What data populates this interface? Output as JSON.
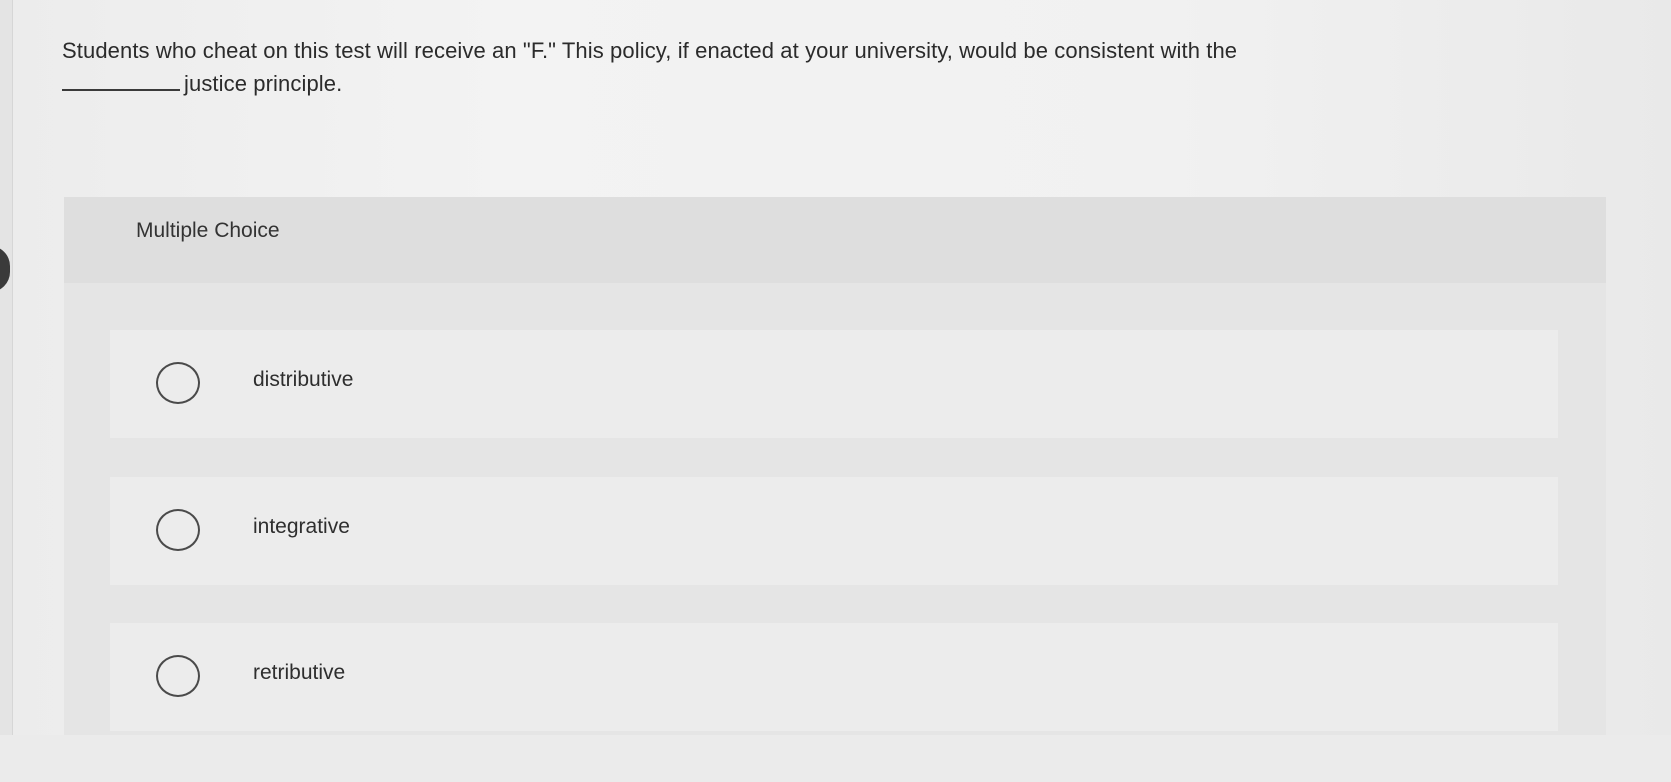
{
  "question": {
    "line1": "Students who cheat on this test will receive an \"F.\" This policy, if enacted at your university, would be consistent with the",
    "line2": "justice principle."
  },
  "multiple_choice": {
    "title": "Multiple Choice",
    "options": [
      {
        "label": "distributive"
      },
      {
        "label": "integrative"
      },
      {
        "label": "retributive"
      }
    ]
  }
}
